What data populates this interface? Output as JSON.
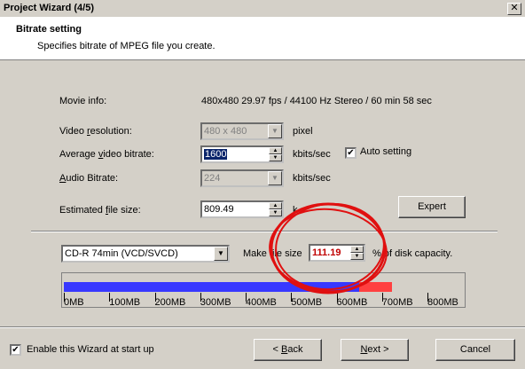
{
  "window": {
    "title": "Project Wizard (4/5)",
    "close_glyph": "✕"
  },
  "header": {
    "heading": "Bitrate setting",
    "subheading": "Specifies bitrate of MPEG file you create."
  },
  "movie_info": {
    "label": "Movie info:",
    "value": "480x480 29.97 fps / 44100 Hz Stereo / 60 min 58 sec"
  },
  "video_resolution": {
    "label_pre": "Video ",
    "label_u": "r",
    "label_post": "esolution:",
    "value": "480 x 480",
    "unit": "pixel",
    "enabled": false
  },
  "average_video_bitrate": {
    "label_pre": "Average ",
    "label_u": "v",
    "label_post": "ideo bitrate:",
    "value": "1600",
    "unit": "kbits/sec"
  },
  "auto_setting": {
    "label": "Auto setting",
    "checked": true,
    "mark": "✔"
  },
  "audio_bitrate": {
    "label_pre": "",
    "label_u": "A",
    "label_post": "udio Bitrate:",
    "value": "224",
    "unit": "kbits/sec",
    "enabled": false
  },
  "estimated_file_size": {
    "label_pre": "Estimated ",
    "label_u": "f",
    "label_post": "ile size:",
    "value": "809.49",
    "unit": "k"
  },
  "expert_button": "Expert",
  "disc_type": {
    "selected": "CD-R 74min (VCD/SVCD)"
  },
  "make_file_size": {
    "label": "Make file size",
    "value": "111.19",
    "suffix": "% of disk capacity."
  },
  "capacity_bar": {
    "ticks": [
      "0MB",
      "100MB",
      "200MB",
      "300MB",
      "400MB",
      "500MB",
      "600MB",
      "700MB",
      "800MB"
    ],
    "capacity_mb": 650,
    "used_mb": 722.7,
    "fill_color": "#3838ff",
    "over_color": "#ff4040"
  },
  "enable_wizard": {
    "label": "Enable this Wizard at start up",
    "checked": true,
    "mark": "✔"
  },
  "buttons": {
    "back_pre": "< ",
    "back_u": "B",
    "back_post": "ack",
    "next_u": "N",
    "next_post": "ext >",
    "cancel": "Cancel"
  },
  "annotation_color": "#e01010"
}
